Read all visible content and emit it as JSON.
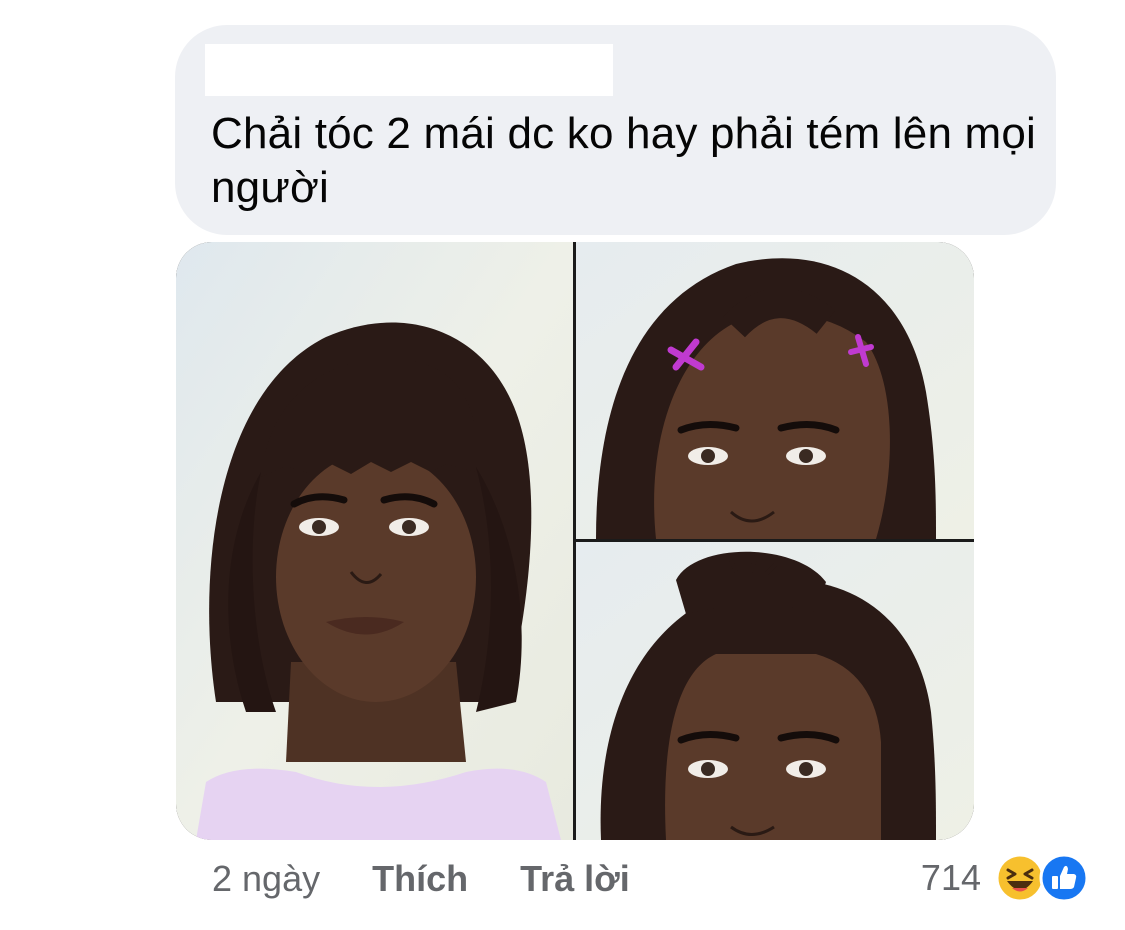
{
  "comment": {
    "text": "Chải tóc 2 mái dc ko hay phải tém lên mọi người"
  },
  "attachment": {
    "panels": [
      "straight-bangs-bob",
      "side-clipped-part",
      "pompadour-top"
    ],
    "colors": {
      "skin": "#5a3a2a",
      "hair": "#2a1a16",
      "clip": "#c03ad0",
      "top": "#e6d3f2"
    }
  },
  "actions": {
    "time": "2 ngày",
    "like_label": "Thích",
    "reply_label": "Trả lời"
  },
  "reactions": {
    "count": "714",
    "icons": [
      "haha-icon",
      "like-icon"
    ],
    "colors": {
      "haha": "#f7c02e",
      "like": "#1877f2"
    }
  }
}
